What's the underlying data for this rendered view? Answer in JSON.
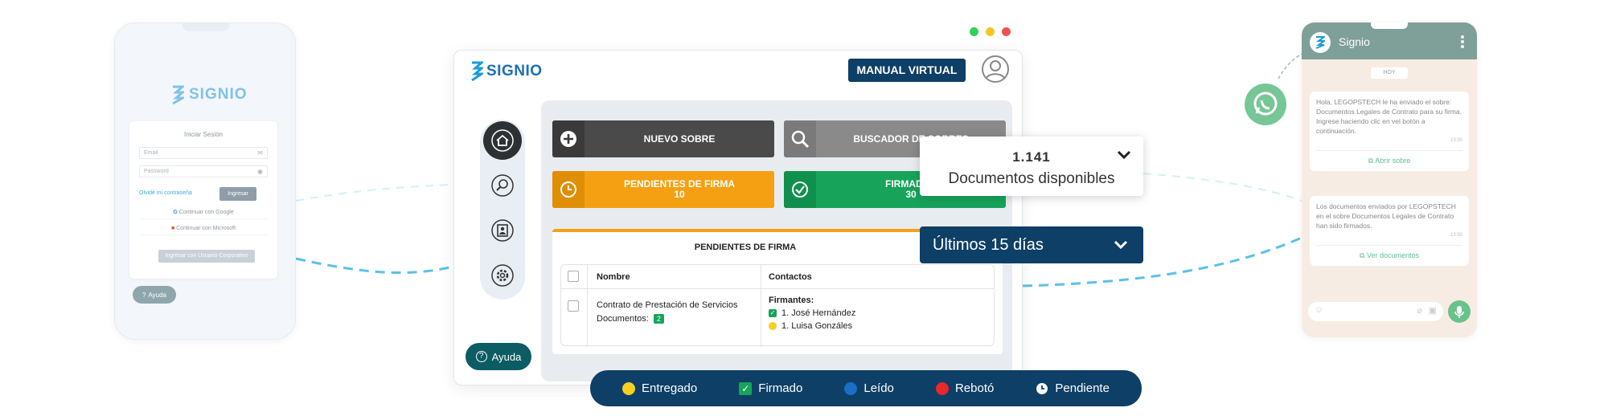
{
  "brand": {
    "name": "SIGNIO"
  },
  "login_phone": {
    "title": "Iniciar Sesión",
    "email_placeholder": "Email",
    "password_placeholder": "Password",
    "forgot_label": "Olvidé mi contraseña",
    "login_label": "Ingresar",
    "google_label": "Continuar con Google",
    "microsoft_label": "Continuar con Microsoft",
    "corporate_label": "Ingresar con Usuario Corporativo",
    "help_label": "Ayuda"
  },
  "window": {
    "manual_label": "MANUAL VIRTUAL",
    "help_label": "Ayuda",
    "sidebar": [
      "home-icon",
      "search-icon",
      "contacts-icon",
      "settings-icon"
    ],
    "tiles": {
      "new_envelope": "NUEVO SOBRE",
      "envelope_search": "BUSCADOR DE SOBRES",
      "pending_label": "PENDIENTES DE FIRMA",
      "pending_count": "10",
      "signed_label": "FIRMADOS",
      "signed_count": "30"
    },
    "table": {
      "title": "PENDIENTES DE FIRMA",
      "headers": [
        "Nombre",
        "Contactos"
      ],
      "row": {
        "name": "Contrato de Prestación de Servicios",
        "docs_label": "Documentos:",
        "docs_count": "2",
        "signers_label": "Firmantes:",
        "signers": [
          "1. José Hernández",
          "1. Luisa Gonzáles"
        ]
      }
    }
  },
  "docs_card": {
    "count": "1.141",
    "label": "Documentos disponibles"
  },
  "range_select": {
    "value": "Últimos 15 días"
  },
  "legend": {
    "items": [
      {
        "label": "Entregado",
        "color": "#f5d020"
      },
      {
        "label": "Firmado",
        "color": "#17a35a"
      },
      {
        "label": "Leído",
        "color": "#1a6fc4"
      },
      {
        "label": "Rebotó",
        "color": "#e8282a"
      },
      {
        "label": "Pendiente",
        "color": "#ffffff"
      }
    ]
  },
  "chat_phone": {
    "name": "Signio",
    "today": "HOY",
    "messages": [
      {
        "text": "Hola, LEGOPSTECH le ha enviado el sobre: Documentos Legales de Contrato para su firma. Ingrese haciendo clic en vel botón a continuación.",
        "time": "13:30",
        "action": "Abrir sobre"
      },
      {
        "text": "Los documentos enviados por LEGOPSTECH en el sobre Documentos Legales de Contrato han sido firmados.",
        "time": "13:30",
        "action": "Ver documentos"
      }
    ]
  },
  "colors": {
    "navy": "#0e3f66",
    "orange": "#f5a012",
    "green": "#17a35a",
    "teal": "#0b5c63"
  }
}
